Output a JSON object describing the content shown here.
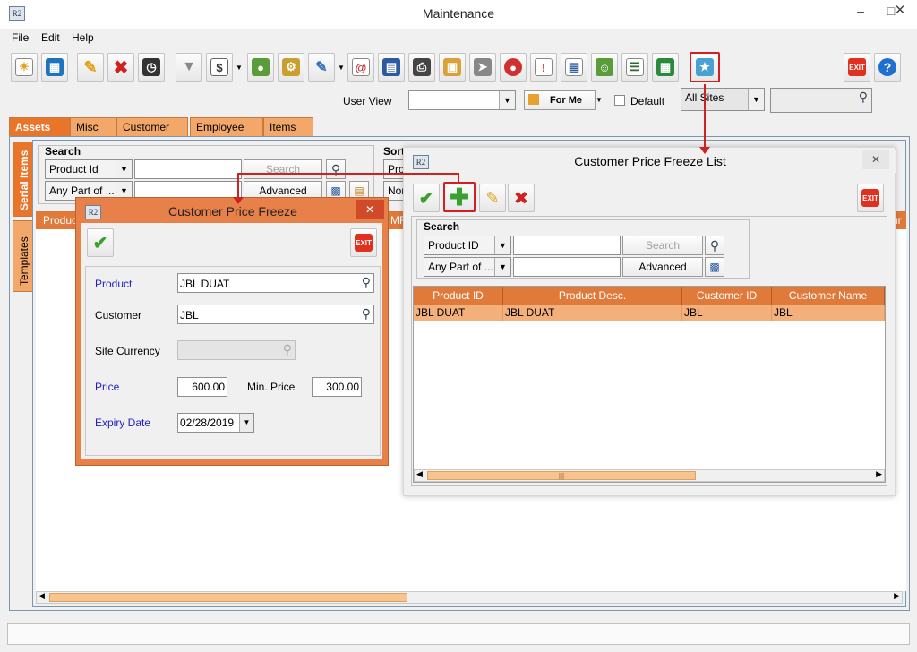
{
  "window": {
    "title": "Maintenance",
    "app_icon": "R2"
  },
  "menu": [
    "File",
    "Edit",
    "Help"
  ],
  "toolbar": {
    "user_view_label": "User View",
    "for_me_label": "For Me",
    "default_label": "Default",
    "sites_value": "All Sites"
  },
  "tabs": [
    "Assets",
    "Misc",
    "Customer",
    "Employee",
    "Items"
  ],
  "vtabs": [
    "Serial Items",
    "Templates"
  ],
  "main_search": {
    "label": "Search",
    "field1": "Product Id",
    "field2": "Any Part of ...",
    "search_btn": "Search",
    "advanced_btn": "Advanced",
    "sort_label": "Sort",
    "sort1": "Pro",
    "sort2": "Non",
    "grid_partial": "Produc",
    "grid_partial2": "MF",
    "grid_partial3": "ur"
  },
  "freeze_list": {
    "title": "Customer Price Freeze List",
    "app_icon": "R2",
    "exit_label": "EXIT",
    "search_label": "Search",
    "field1": "Product ID",
    "field2": "Any Part of ...",
    "search_btn": "Search",
    "advanced_btn": "Advanced",
    "columns": [
      "Product ID",
      "Product Desc.",
      "Customer ID",
      "Customer Name"
    ],
    "rows": [
      {
        "product_id": "JBL DUAT",
        "product_desc": "JBL DUAT",
        "customer_id": "JBL",
        "customer_name": "JBL"
      }
    ],
    "scroll_grip": "|||"
  },
  "freeze_dialog": {
    "title": "Customer Price Freeze",
    "app_icon": "R2",
    "exit_label": "EXIT",
    "product_label": "Product",
    "product_value": "JBL DUAT",
    "customer_label": "Customer",
    "customer_value": "JBL",
    "site_currency_label": "Site Currency",
    "price_label": "Price",
    "price_value": "600.00",
    "min_price_label": "Min. Price",
    "min_price_value": "300.00",
    "expiry_label": "Expiry Date",
    "expiry_value": "02/28/2019"
  },
  "exit_label": "EXIT",
  "colors": {
    "accent": "#e8752a",
    "highlight": "#cc2222",
    "row_select": "#f4b07a"
  }
}
